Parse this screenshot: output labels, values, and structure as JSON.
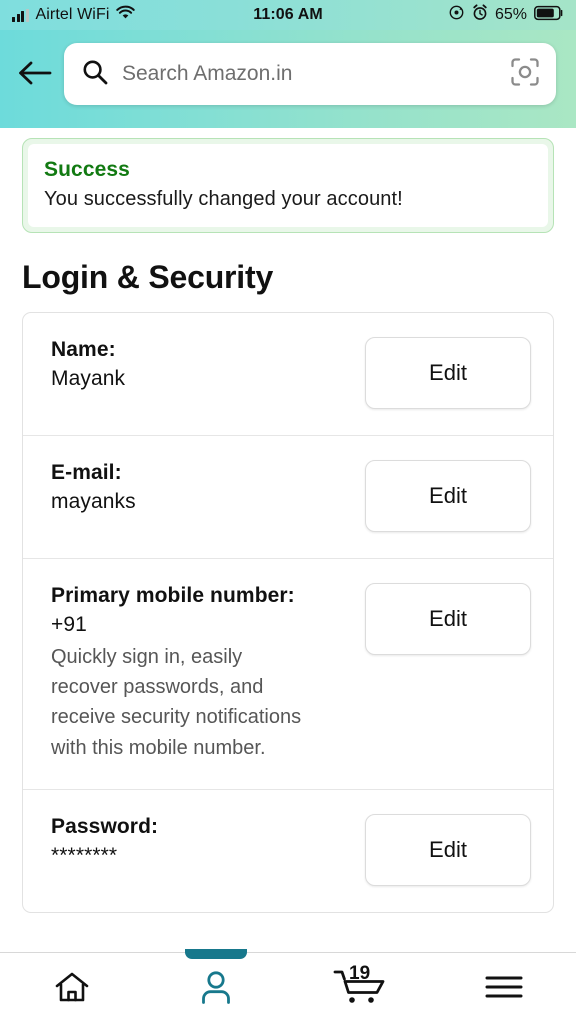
{
  "status_bar": {
    "carrier": "Airtel WiFi",
    "time": "11:06 AM",
    "battery_percent": "65%",
    "icons": [
      "signal-bars-icon",
      "wifi-icon",
      "rotation-lock-icon",
      "alarm-clock-icon",
      "battery-icon"
    ]
  },
  "header": {
    "back_icon": "back-arrow-icon",
    "search_placeholder": "Search Amazon.in",
    "search_value": "",
    "search_icon": "search-icon",
    "lens_icon": "camera-lens-scan-icon",
    "gradient_from": "#6ddbdb",
    "gradient_to": "#aae7c4"
  },
  "alert": {
    "title": "Success",
    "message": "You successfully changed your account!",
    "title_color": "#127a12",
    "border_color": "#b6e3b6"
  },
  "page": {
    "title": "Login & Security"
  },
  "rows": [
    {
      "label": "Name:",
      "value": "Mayank",
      "description": "",
      "button": "Edit"
    },
    {
      "label": "E-mail:",
      "value": "mayanks",
      "description": "",
      "button": "Edit"
    },
    {
      "label": "Primary mobile number:",
      "value": "+91",
      "description": "Quickly sign in, easily recover passwords, and receive security notifications with this mobile number.",
      "button": "Edit"
    },
    {
      "label": "Password:",
      "value": "********",
      "description": "",
      "button": "Edit"
    }
  ],
  "bottom_nav": {
    "active_color": "#17788c",
    "items": [
      {
        "name": "home",
        "icon": "home-icon",
        "active": false
      },
      {
        "name": "account",
        "icon": "person-icon",
        "active": true
      },
      {
        "name": "cart",
        "icon": "cart-icon",
        "badge": "19",
        "active": false
      },
      {
        "name": "menu",
        "icon": "hamburger-menu-icon",
        "active": false
      }
    ]
  }
}
